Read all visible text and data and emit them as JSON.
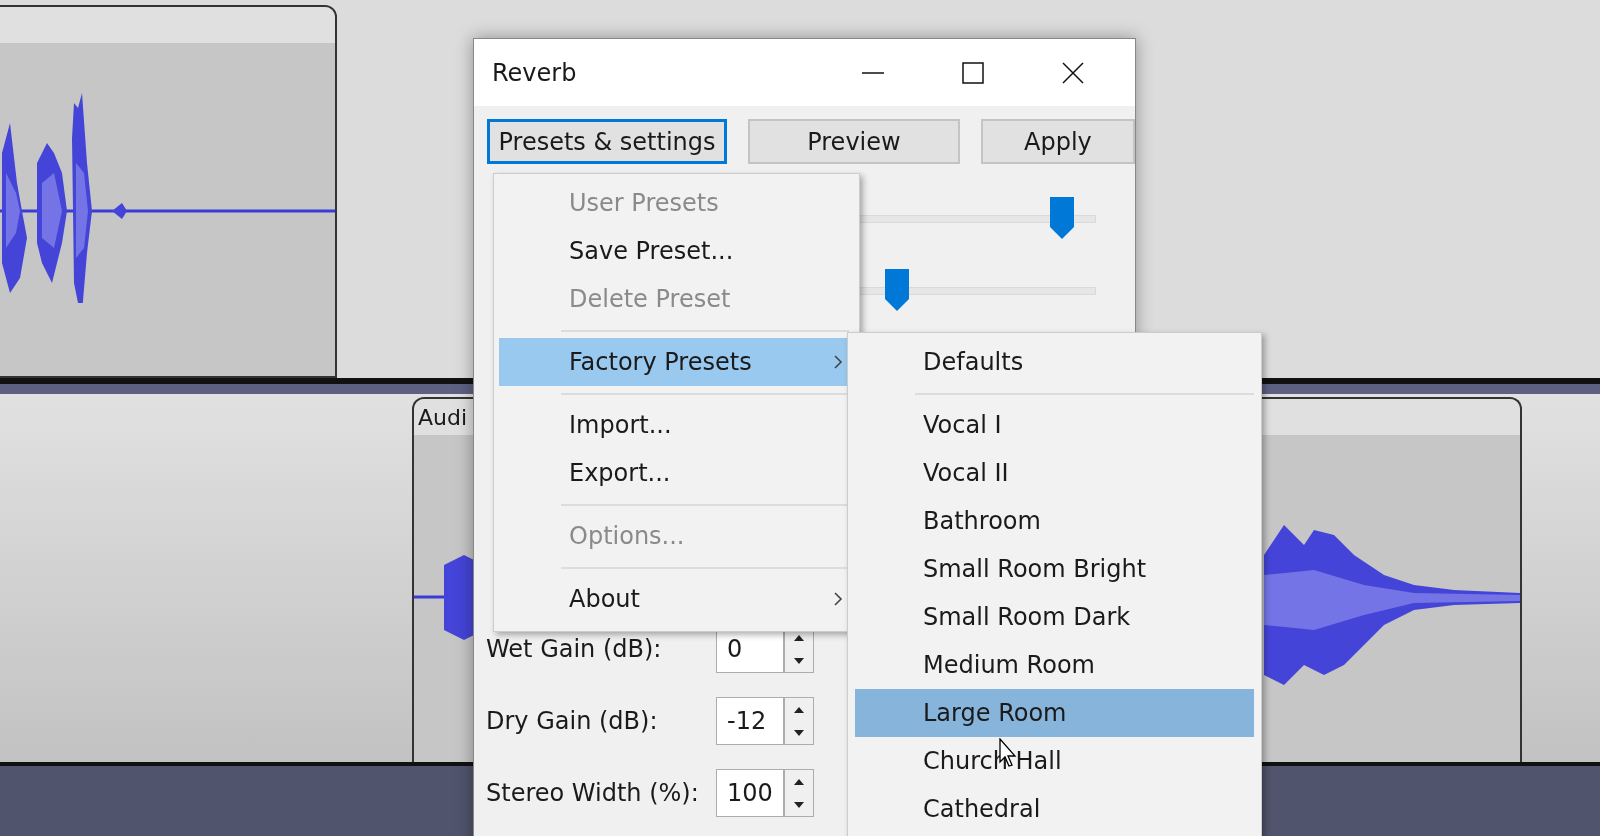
{
  "track_clip": {
    "label": "Audi"
  },
  "dialog": {
    "title": "Reverb",
    "buttons": [
      {
        "label": "Presets & settings",
        "focused": true
      },
      {
        "label": "Preview",
        "focused": false
      },
      {
        "label": "Apply",
        "focused": false
      }
    ],
    "sliders": [
      {
        "level": 0.86
      },
      {
        "level": 0.17
      }
    ],
    "fields": [
      {
        "label": "Wet Gain (dB):",
        "value": "0"
      },
      {
        "label": "Dry Gain (dB):",
        "value": "-12"
      },
      {
        "label": "Stereo Width (%):",
        "value": "100"
      }
    ]
  },
  "menu": {
    "items": [
      {
        "kind": "item",
        "label": "User Presets",
        "disabled": true,
        "selected": false,
        "submenu": false
      },
      {
        "kind": "item",
        "label": "Save Preset...",
        "disabled": false,
        "selected": false,
        "submenu": false
      },
      {
        "kind": "item",
        "label": "Delete Preset",
        "disabled": true,
        "selected": false,
        "submenu": false
      },
      {
        "kind": "separator"
      },
      {
        "kind": "item",
        "label": "Factory Presets",
        "disabled": false,
        "selected": true,
        "submenu": true
      },
      {
        "kind": "separator"
      },
      {
        "kind": "item",
        "label": "Import...",
        "disabled": false,
        "selected": false,
        "submenu": false
      },
      {
        "kind": "item",
        "label": "Export...",
        "disabled": false,
        "selected": false,
        "submenu": false
      },
      {
        "kind": "separator"
      },
      {
        "kind": "item",
        "label": "Options...",
        "disabled": true,
        "selected": false,
        "submenu": false
      },
      {
        "kind": "separator"
      },
      {
        "kind": "item",
        "label": "About",
        "disabled": false,
        "selected": false,
        "submenu": true
      }
    ]
  },
  "submenu": {
    "items": [
      {
        "kind": "item",
        "label": "Defaults",
        "selected": false
      },
      {
        "kind": "separator"
      },
      {
        "kind": "item",
        "label": "Vocal I",
        "selected": false
      },
      {
        "kind": "item",
        "label": "Vocal II",
        "selected": false
      },
      {
        "kind": "item",
        "label": "Bathroom",
        "selected": false
      },
      {
        "kind": "item",
        "label": "Small Room Bright",
        "selected": false
      },
      {
        "kind": "item",
        "label": "Small Room Dark",
        "selected": false
      },
      {
        "kind": "item",
        "label": "Medium Room",
        "selected": false
      },
      {
        "kind": "item",
        "label": "Large Room",
        "selected": true
      },
      {
        "kind": "item",
        "label": "Church Hall",
        "selected": false
      },
      {
        "kind": "item",
        "label": "Cathedral",
        "selected": false
      }
    ]
  }
}
